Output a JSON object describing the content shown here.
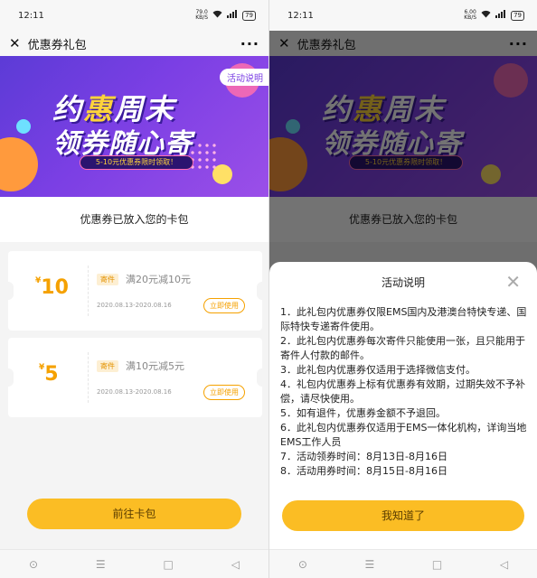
{
  "status": {
    "time": "12:11",
    "left_net_speed": "79.0",
    "left_net_unit": "KB/S",
    "right_net_speed": "6.00",
    "right_net_unit": "KB/S",
    "battery": "79"
  },
  "header": {
    "title": "优惠券礼包",
    "close_icon": "close-icon",
    "more_icon": "more-icon"
  },
  "banner": {
    "title_line1_a": "约",
    "title_line1_hl": "惠",
    "title_line1_b": "周末",
    "title_line2": "领券随心寄",
    "pill": "5-10元优惠券限时领取！",
    "rules_tag": "活动说明"
  },
  "notice": "优惠券已放入您的卡包",
  "coupons": [
    {
      "symbol": "¥",
      "amount": "10",
      "tag": "寄件",
      "desc": "满20元减10元",
      "date": "2020.08.13-2020.08.16",
      "button": "立即使用"
    },
    {
      "symbol": "¥",
      "amount": "5",
      "tag": "寄件",
      "desc": "满10元减5元",
      "date": "2020.08.13-2020.08.16",
      "button": "立即使用"
    }
  ],
  "footer_button": "前往卡包",
  "modal": {
    "title": "活动说明",
    "rules": [
      "1．此礼包内优惠券仅限EMS国内及港澳台特快专递、国际特快专递寄件使用。",
      "2．此礼包内优惠券每次寄件只能使用一张，且只能用于寄件人付款的邮件。",
      "3．此礼包内优惠券仅适用于选择微信支付。",
      "4．礼包内优惠券上标有优惠券有效期，过期失效不予补偿，请尽快使用。",
      "5．如有退件，优惠券金额不予退回。",
      "6．此礼包内优惠券仅适用于EMS一体化机构，详询当地EMS工作人员",
      "7．活动领券时间：8月13日-8月16日",
      "8．活动用券时间：8月15日-8月16日"
    ],
    "button": "我知道了"
  },
  "nav": {
    "home": "⊙",
    "menu": "☰",
    "square": "□",
    "back": "◁"
  }
}
